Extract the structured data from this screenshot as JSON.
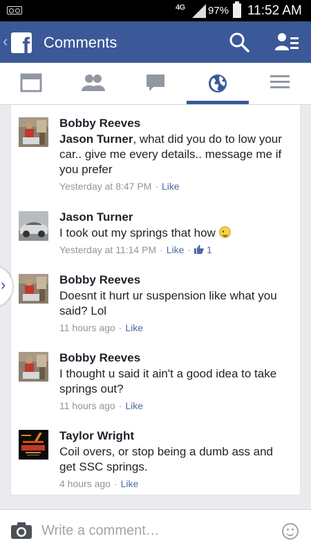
{
  "status_bar": {
    "network": "4G",
    "battery": "97%",
    "time": "11:52 AM"
  },
  "header": {
    "title": "Comments",
    "back_icon": "chevron-left-icon",
    "logo_icon": "facebook-logo-icon"
  },
  "tabs": [
    {
      "icon": "news-feed-icon",
      "active": false
    },
    {
      "icon": "friends-icon",
      "active": false
    },
    {
      "icon": "messages-icon",
      "active": false
    },
    {
      "icon": "globe-icon",
      "active": true
    },
    {
      "icon": "menu-icon",
      "active": false
    }
  ],
  "comments": [
    {
      "author": "Bobby Reeves",
      "mention": "Jason Turner",
      "text": ", what did you do to low your car.. give me every details.. message me if you prefer",
      "time": "Yesterday at 8:47 PM",
      "like_label": "Like"
    },
    {
      "author": "Jason Turner",
      "text": "I took out my springs that how",
      "time": "Yesterday at 11:14 PM",
      "like_label": "Like",
      "like_count": "1"
    },
    {
      "author": "Bobby Reeves",
      "text": "Doesnt it hurt ur suspension like what you said? Lol",
      "time": "11 hours ago",
      "like_label": "Like"
    },
    {
      "author": "Bobby Reeves",
      "text": "I thought u said it ain't a good idea to take springs out?",
      "time": "11 hours ago",
      "like_label": "Like"
    },
    {
      "author": "Taylor Wright",
      "text": "Coil overs, or stop being a dumb ass and get SSC springs.",
      "time": "4 hours ago",
      "like_label": "Like"
    }
  ],
  "composer": {
    "placeholder": "Write a comment…"
  },
  "colors": {
    "brand": "#3b5998",
    "link": "#4b6aa6",
    "meta": "#90949c"
  }
}
